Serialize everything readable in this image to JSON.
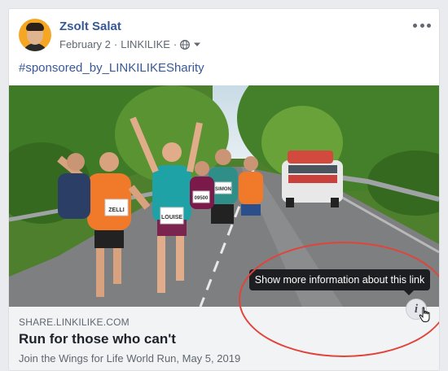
{
  "post": {
    "author": "Zsolt Salat",
    "date": "February 2",
    "separator": "·",
    "page": "LINKILIKE",
    "hashtag": "#sponsored_by_LINKILIKESharity"
  },
  "link": {
    "domain": "SHARE.LINKILIKE.COM",
    "title": "Run for those who can't",
    "description": "Join the Wings for Life World Run, May 5, 2019"
  },
  "bibs": [
    "LOUISE",
    "ZELLI",
    "09500",
    "SIMON"
  ],
  "tooltip": "Show more information about this link",
  "info_glyph": "i",
  "icons": [
    "globe-icon",
    "chevron-down-icon",
    "more-icon",
    "info-icon",
    "hand-cursor-icon"
  ],
  "colors": {
    "author": "#365899",
    "highlight": "#e0443a",
    "tooltip_bg": "#1c1e21"
  }
}
